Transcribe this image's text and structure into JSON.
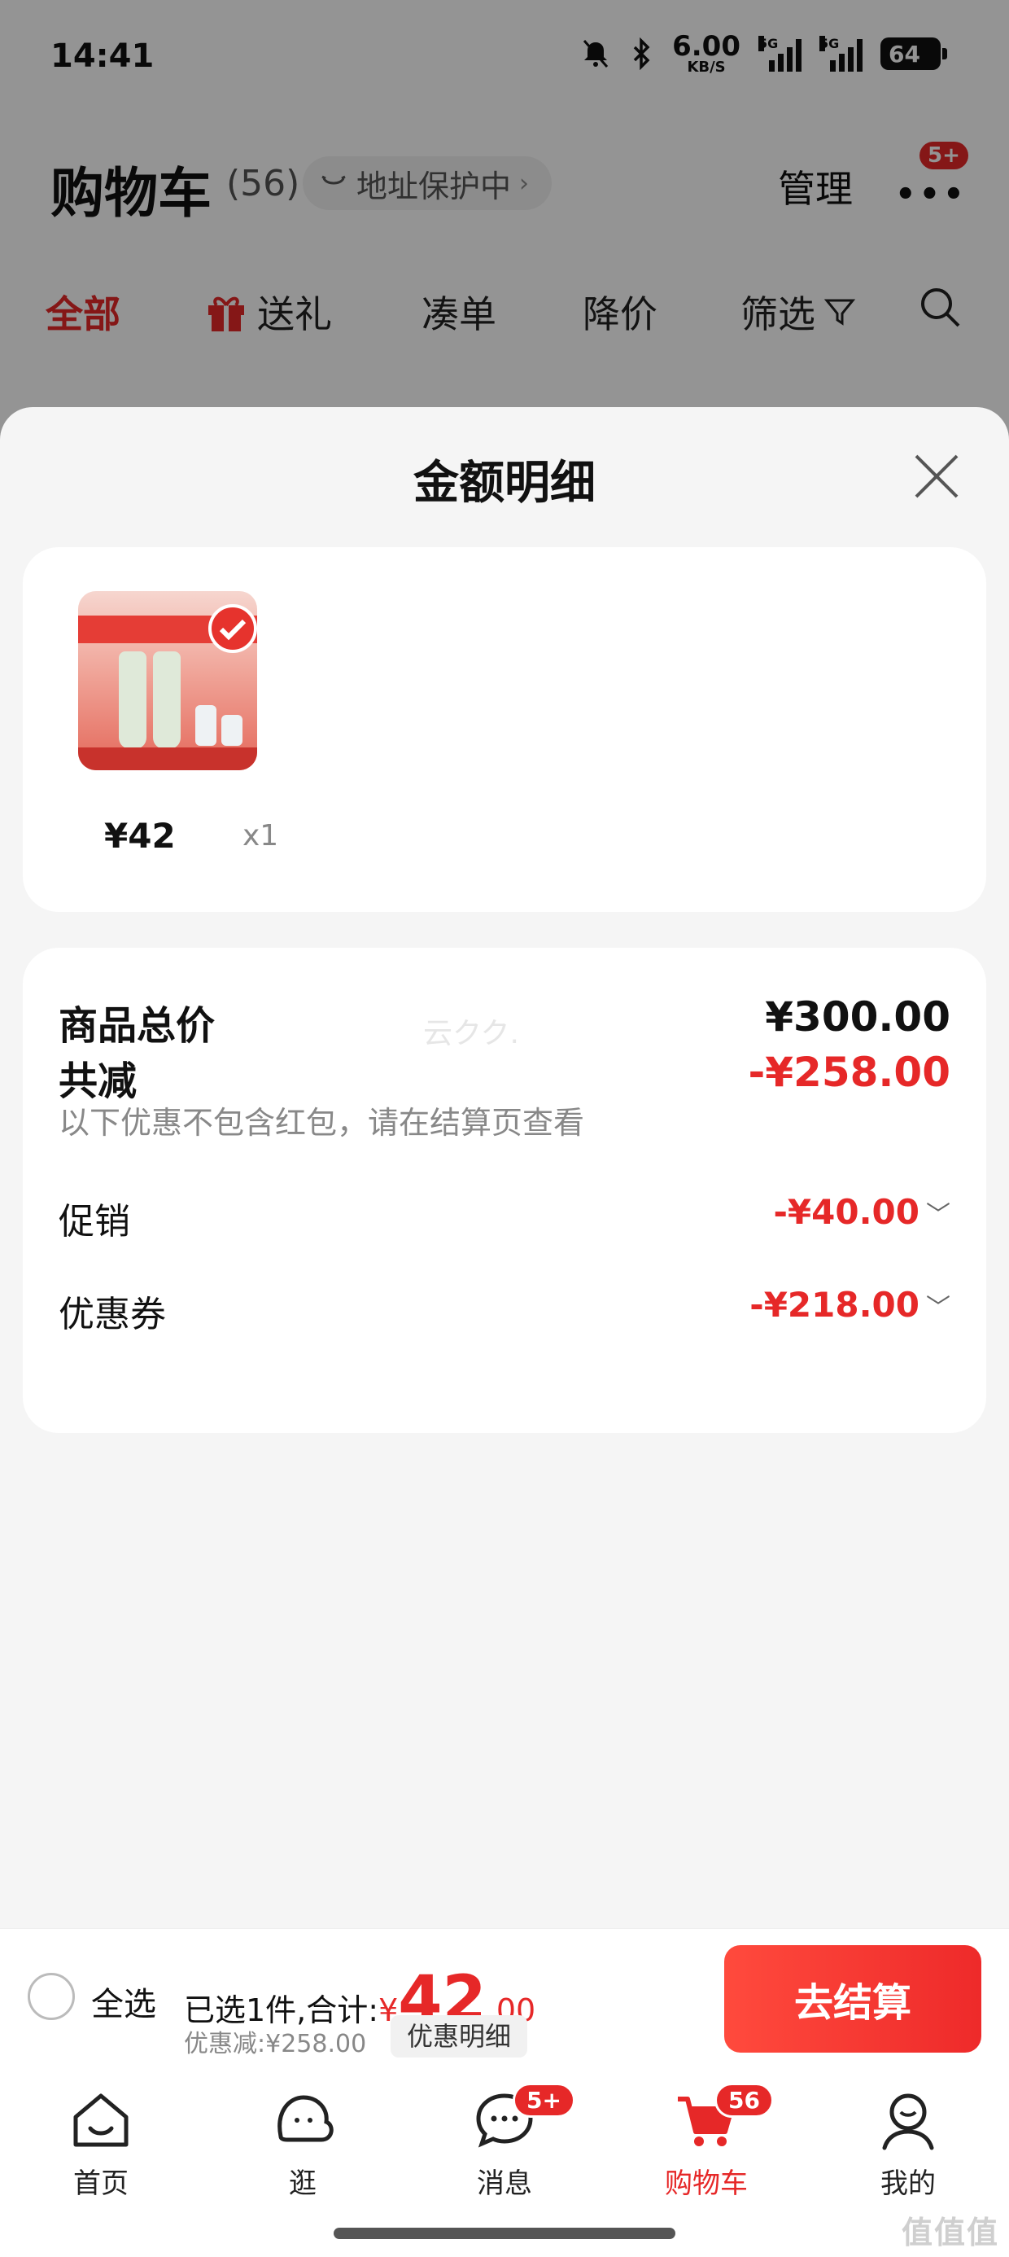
{
  "status_bar": {
    "time": "14:41",
    "net_speed": "6.00",
    "net_unit": "KB/S",
    "signal1_label": "5G",
    "signal2_label": "5G",
    "battery": "64"
  },
  "header": {
    "title": "购物车",
    "count": "(56)",
    "address_protect": "地址保护中",
    "manage": "管理",
    "more_badge": "5+"
  },
  "tabs": [
    {
      "label": "全部"
    },
    {
      "label": "送礼"
    },
    {
      "label": "凑单"
    },
    {
      "label": "降价"
    },
    {
      "label": "筛选"
    }
  ],
  "sheet": {
    "title": "金额明细",
    "item": {
      "price": "¥42",
      "quantity": "x1"
    },
    "total_label": "商品总价",
    "total_value": "¥300.00",
    "reduce_label": "共减",
    "reduce_value": "-¥258.00",
    "note": "以下优惠不包含红包，请在结算页查看",
    "promo_label": "促销",
    "promo_value": "-¥40.00",
    "coupon_label": "优惠券",
    "coupon_value": "-¥218.00",
    "watermark": "云クク."
  },
  "checkout": {
    "select_all": "全选",
    "selected_prefix": "已选1件,合计:",
    "currency": "¥",
    "amount_int": "42",
    "amount_dec": ".00",
    "discount": "优惠减:¥258.00",
    "detail_button": "优惠明细",
    "pay_button": "去结算"
  },
  "tabbar": [
    {
      "label": "首页"
    },
    {
      "label": "逛"
    },
    {
      "label": "消息",
      "badge": "5+"
    },
    {
      "label": "购物车",
      "badge": "56"
    },
    {
      "label": "我的"
    }
  ],
  "corner_watermark": "值值值",
  "colors": {
    "accent": "#e62828",
    "background": "#f5f5f5"
  }
}
